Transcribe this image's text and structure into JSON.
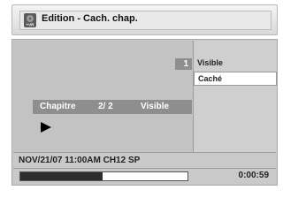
{
  "header": {
    "icon": "vr-disc-icon",
    "icon_text": "+VR",
    "title": "Edition - Cach. chap."
  },
  "preview": {
    "chapter_badge": "1",
    "chapter_label": "Chapitre",
    "chapter_position": "2/ 2",
    "chapter_status": "Visible",
    "playback_icon": "play-icon"
  },
  "options": {
    "label": "Visible",
    "selected": "Caché"
  },
  "info": {
    "recording_info": "NOV/21/07 11:00AM CH12 SP"
  },
  "playback": {
    "progress_fraction": 0.49,
    "time": "0:00:59"
  },
  "colors": {
    "bar_gray": "#8e8e8e",
    "panel_gray": "#c9c9c9",
    "progress_fill": "#2e2e2e"
  }
}
